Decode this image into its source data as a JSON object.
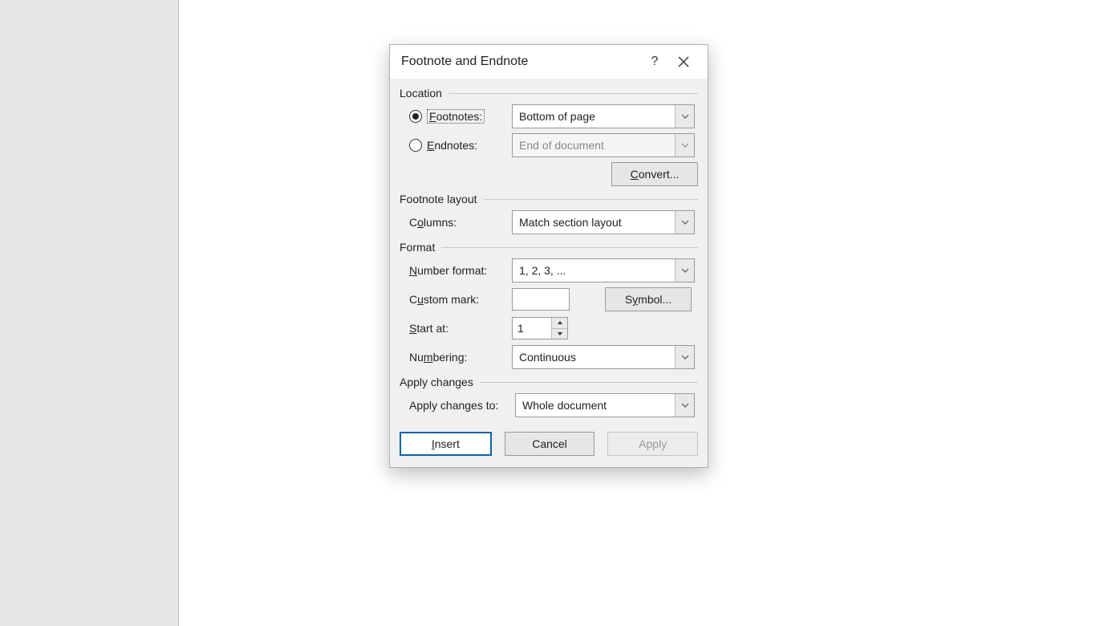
{
  "dialog": {
    "title": "Footnote and Endnote",
    "groups": {
      "location": {
        "title": "Location",
        "footnotes_label": "Footnotes:",
        "footnotes_value": "Bottom of page",
        "endnotes_label": "Endnotes:",
        "endnotes_value": "End of document",
        "convert_label": "Convert..."
      },
      "layout": {
        "title": "Footnote layout",
        "columns_label": "Columns:",
        "columns_value": "Match section layout"
      },
      "format": {
        "title": "Format",
        "number_format_label": "Number format:",
        "number_format_value": "1, 2, 3, ...",
        "custom_mark_label": "Custom mark:",
        "custom_mark_value": "",
        "symbol_label": "Symbol...",
        "start_at_label": "Start at:",
        "start_at_value": "1",
        "numbering_label": "Numbering:",
        "numbering_value": "Continuous"
      },
      "apply": {
        "title": "Apply changes",
        "apply_to_label": "Apply changes to:",
        "apply_to_value": "Whole document"
      }
    },
    "actions": {
      "insert": "Insert",
      "cancel": "Cancel",
      "apply": "Apply"
    }
  }
}
